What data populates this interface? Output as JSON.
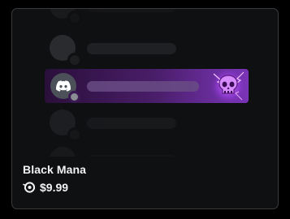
{
  "item": {
    "name": "Black Mana",
    "price": "$9.99",
    "currency_icon": "orb-icon",
    "accent_color": "#7a34b8"
  },
  "preview": {
    "rows": 4,
    "highlight_icon": "discord-icon",
    "decoration_icon": "skull-icon"
  }
}
